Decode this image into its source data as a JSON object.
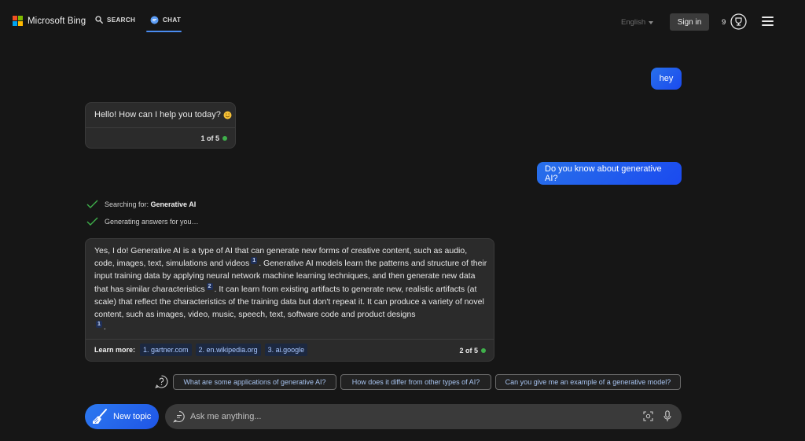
{
  "header": {
    "brand": "Microsoft Bing",
    "nav": {
      "search": "SEARCH",
      "chat": "CHAT"
    },
    "language": "English",
    "sign_in": "Sign in",
    "rewards_count": "9"
  },
  "conversation": {
    "user_msg_1": "hey",
    "bot_msg_1": "Hello! How can I help you today?",
    "bot_msg_1_count": "1 of 5",
    "user_msg_2": "Do you know about generative AI?",
    "progress": {
      "searching_prefix": "Searching for: ",
      "searching_term": "Generative AI",
      "generating": "Generating answers for you…"
    },
    "bot_msg_2": {
      "part1": "Yes, I do! Generative AI is a type of AI that can generate new forms of creative content, such as audio, code, images, text, simulations and videos",
      "cite1": "1",
      "part2": ". Generative AI models learn the patterns and structure of their input training data by applying neural network machine learning techniques, and then generate new data that has similar characteristics",
      "cite2": "2",
      "part3": ". It can learn from existing artifacts to generate new, realistic artifacts (at scale) that reflect the characteristics of the training data but don't repeat it. It can produce a variety of novel content, such as images, video, music, speech, text, software code and product designs",
      "cite3": "1",
      "part4": "."
    },
    "learn_more_label": "Learn more:",
    "sources": [
      "1. gartner.com",
      "2. en.wikipedia.org",
      "3. ai.google"
    ],
    "bot_msg_2_count": "2 of 5"
  },
  "suggestions": [
    "What are some applications of generative AI?",
    "How does it differ from other types of AI?",
    "Can you give me an example of a generative model?"
  ],
  "composer": {
    "new_topic": "New topic",
    "placeholder": "Ask me anything..."
  },
  "colors": {
    "accent": "#1b4aef",
    "background": "#161616",
    "status_green": "#3fb04b"
  }
}
